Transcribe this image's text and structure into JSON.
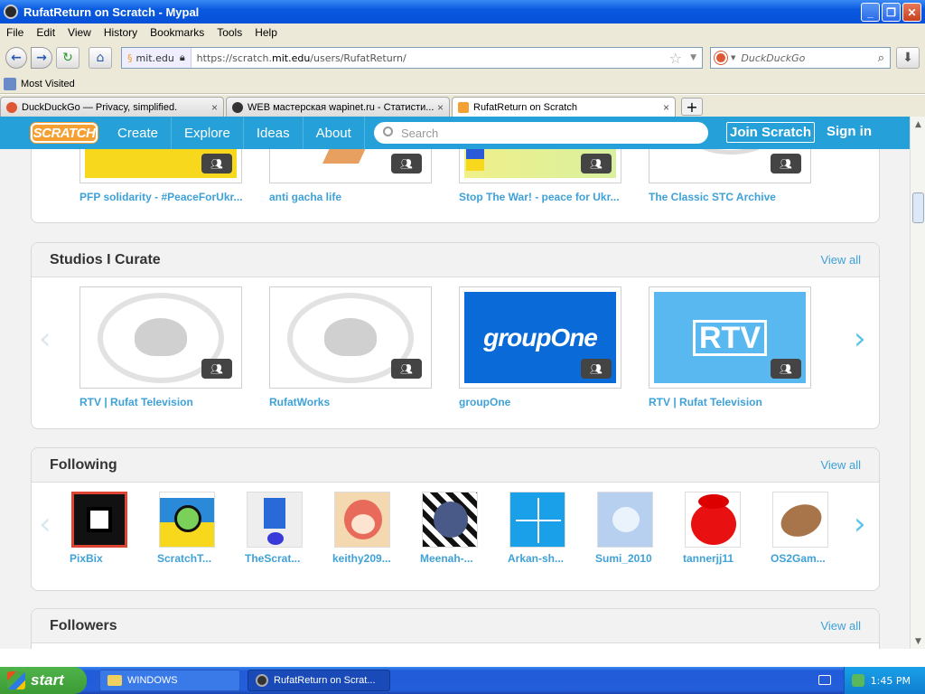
{
  "window": {
    "title": "RufatReturn on Scratch - Mypal"
  },
  "menu": [
    "File",
    "Edit",
    "View",
    "History",
    "Bookmarks",
    "Tools",
    "Help"
  ],
  "nav": {
    "site": "mit.edu",
    "url_prefix": "https://scratch.",
    "url_domain": "mit.edu",
    "url_path": "/users/RufatReturn/",
    "search_placeholder": "DuckDuckGo"
  },
  "bookmarks": {
    "most_visited": "Most Visited"
  },
  "tabs": [
    {
      "label": "DuckDuckGo — Privacy, simplified."
    },
    {
      "label": "WEB мастерская wapinet.ru - Статисти..."
    },
    {
      "label": "RufatReturn on Scratch"
    }
  ],
  "scratch": {
    "logo": "SCRATCH",
    "nav": [
      "Create",
      "Explore",
      "Ideas",
      "About"
    ],
    "search_placeholder": "Search",
    "join": "Join Scratch",
    "signin": "Sign in"
  },
  "top_row": {
    "cards": [
      "PFP solidarity - #PeaceForUkr...",
      "anti gacha life",
      "Stop The War! - peace for Ukr...",
      "The Classic STC Archive"
    ]
  },
  "studios_curate": {
    "title": "Studios I Curate",
    "view_all": "View all",
    "cards": [
      {
        "title": "RTV | Rufat Television"
      },
      {
        "title": "RufatWorks"
      },
      {
        "title": "groupOne",
        "image_text": "groupOne"
      },
      {
        "title": "RTV | Rufat Television",
        "image_text": "RTV"
      }
    ]
  },
  "following": {
    "title": "Following",
    "view_all": "View all",
    "users": [
      "PixBix",
      "ScratchT...",
      "TheScrat...",
      "keithy209...",
      "Meenah-...",
      "Arkan-sh...",
      "Sumi_2010",
      "tannerjj11",
      "OS2Gam..."
    ]
  },
  "followers": {
    "title": "Followers",
    "view_all": "View all"
  },
  "taskbar": {
    "start": "start",
    "items": [
      "WINDOWS",
      "RufatReturn on Scrat..."
    ],
    "clock": "1:45 PM"
  }
}
